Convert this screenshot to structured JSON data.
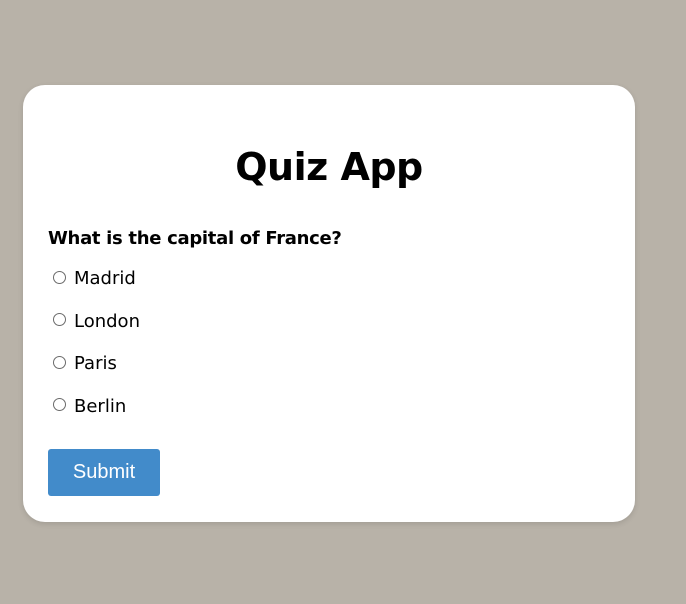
{
  "app": {
    "title": "Quiz App"
  },
  "quiz": {
    "question": "What is the capital of France?",
    "options": [
      {
        "label": "Madrid"
      },
      {
        "label": "London"
      },
      {
        "label": "Paris"
      },
      {
        "label": "Berlin"
      }
    ],
    "submit_label": "Submit"
  },
  "colors": {
    "background": "#b8b2a8",
    "card": "#ffffff",
    "submit_button": "#428bca",
    "submit_text": "#ffffff"
  },
  "icons": {
    "option_marker": "radio-unchecked-icon"
  }
}
